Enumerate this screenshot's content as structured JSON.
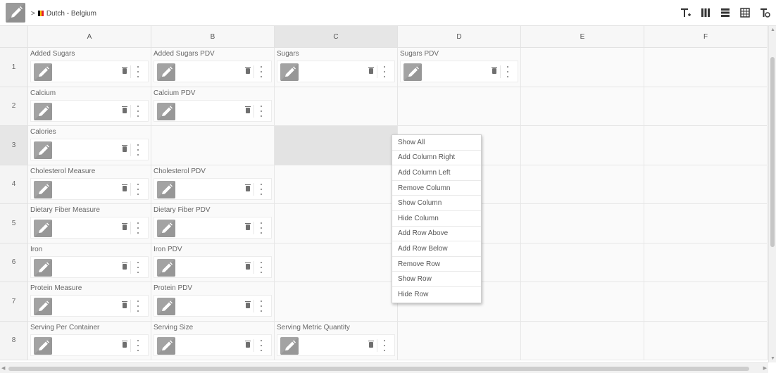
{
  "breadcrumb": {
    "chevron": ">",
    "language": "Dutch - Belgium"
  },
  "flag_colors": [
    "#000000",
    "#f5c400",
    "#e4202e"
  ],
  "toolbar": [
    "text-add-icon",
    "columns-icon",
    "rows-icon",
    "table-icon",
    "settings-icon"
  ],
  "columns": [
    "A",
    "B",
    "C",
    "D",
    "E",
    "F"
  ],
  "rows": [
    "1",
    "2",
    "3",
    "4",
    "5",
    "6",
    "7",
    "8"
  ],
  "selected": {
    "column": "C",
    "row": "3"
  },
  "cells": [
    {
      "row": 0,
      "col": 0,
      "label": "Added Sugars"
    },
    {
      "row": 0,
      "col": 1,
      "label": "Added Sugars PDV"
    },
    {
      "row": 0,
      "col": 2,
      "label": "Sugars"
    },
    {
      "row": 0,
      "col": 3,
      "label": "Sugars PDV"
    },
    {
      "row": 1,
      "col": 0,
      "label": "Calcium"
    },
    {
      "row": 1,
      "col": 1,
      "label": "Calcium PDV"
    },
    {
      "row": 2,
      "col": 0,
      "label": "Calories"
    },
    {
      "row": 3,
      "col": 0,
      "label": "Cholesterol Measure"
    },
    {
      "row": 3,
      "col": 1,
      "label": "Cholesterol PDV"
    },
    {
      "row": 4,
      "col": 0,
      "label": "Dietary Fiber Measure"
    },
    {
      "row": 4,
      "col": 1,
      "label": "Dietary Fiber PDV"
    },
    {
      "row": 5,
      "col": 0,
      "label": "Iron"
    },
    {
      "row": 5,
      "col": 1,
      "label": "Iron PDV"
    },
    {
      "row": 6,
      "col": 0,
      "label": "Protein Measure"
    },
    {
      "row": 6,
      "col": 1,
      "label": "Protein PDV"
    },
    {
      "row": 7,
      "col": 0,
      "label": "Serving Per Container"
    },
    {
      "row": 7,
      "col": 1,
      "label": "Serving Size"
    },
    {
      "row": 7,
      "col": 2,
      "label": "Serving Metric Quantity"
    }
  ],
  "context_menu": [
    "Show All",
    "Add Column Right",
    "Add Column Left",
    "Remove Column",
    "Show Column",
    "Hide Column",
    "Add Row Above",
    "Add Row Below",
    "Remove Row",
    "Show Row",
    "Hide Row"
  ]
}
